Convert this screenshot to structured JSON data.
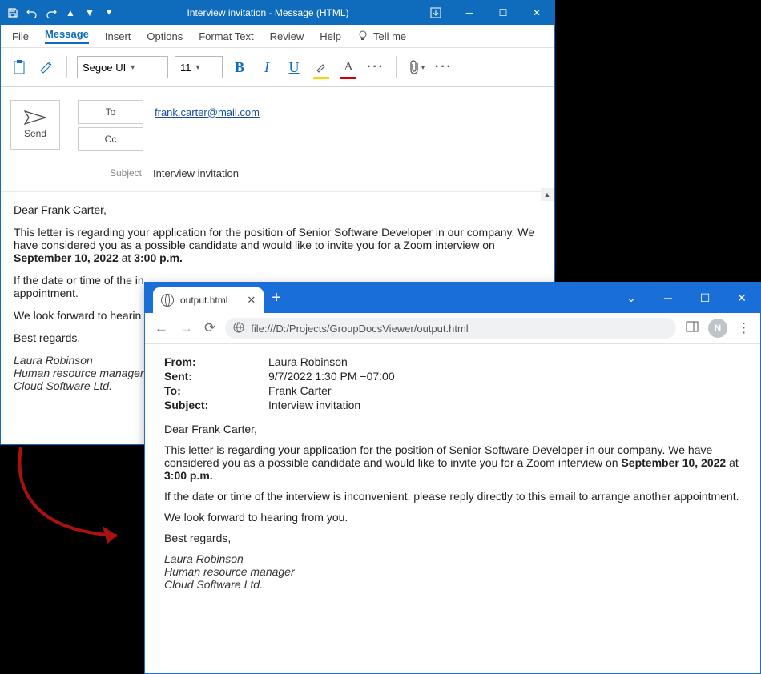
{
  "outlook": {
    "title": "Interview invitation  -  Message (HTML)",
    "menu": [
      "File",
      "Message",
      "Insert",
      "Options",
      "Format Text",
      "Review",
      "Help",
      "Tell me"
    ],
    "font_name": "Segoe UI",
    "font_size": "11",
    "send": "Send",
    "to_btn": "To",
    "cc_btn": "Cc",
    "subject_label": "Subject",
    "to_val": "frank.carter@mail.com",
    "subject_val": "Interview invitation",
    "body": {
      "greeting": "Dear Frank Carter,",
      "p1a": "This letter is regarding your application for the position of Senior Software Developer in our company. We have considered you as a possible candidate and would like to invite you for a Zoom interview on ",
      "date": "September 10, 2022",
      "at": " at ",
      "time": "3:00 p.m.",
      "p2": "If the date or time of the in",
      "p2b": "appointment.",
      "p3": "We look forward to hearin",
      "closing": "Best regards,",
      "sig1": "Laura Robinson",
      "sig2": "Human resource manager",
      "sig3": "Cloud Software Ltd."
    }
  },
  "browser": {
    "tab_title": "output.html",
    "url": "file:///D:/Projects/GroupDocsViewer/output.html",
    "avatar": "N",
    "from_l": "From:",
    "from_v": "Laura Robinson",
    "sent_l": "Sent:",
    "sent_v": "9/7/2022 1:30 PM −07:00",
    "to_l": "To:",
    "to_v": "Frank Carter",
    "subj_l": "Subject:",
    "subj_v": "Interview invitation",
    "greeting": "Dear Frank Carter,",
    "p1a": "This letter is regarding your application for the position of Senior Software Developer in our company. We have considered you as a possible candidate and would like to invite you for a Zoom interview on ",
    "date": "September 10, 2022",
    "at": " at ",
    "time": "3:00 p.m.",
    "p2": "If the date or time of the interview is inconvenient, please reply directly to this email to arrange another appointment.",
    "p3": "We look forward to hearing from you.",
    "closing": "Best regards,",
    "sig1": "Laura Robinson",
    "sig2": "Human resource manager",
    "sig3": "Cloud Software Ltd."
  }
}
